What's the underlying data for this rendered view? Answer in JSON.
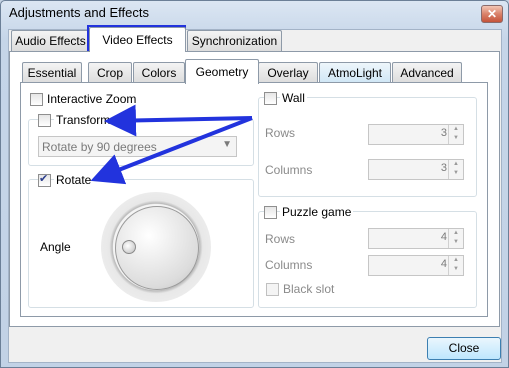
{
  "window": {
    "title": "Adjustments and Effects",
    "close_glyph": "✕"
  },
  "main_tabs": [
    {
      "label": "Audio Effects"
    },
    {
      "label": "Video Effects",
      "active": true
    },
    {
      "label": "Synchronization"
    }
  ],
  "sub_tabs": [
    {
      "label": "Essential"
    },
    {
      "label": "Crop"
    },
    {
      "label": "Colors"
    },
    {
      "label": "Geometry",
      "active": true
    },
    {
      "label": "Overlay"
    },
    {
      "label": "AtmoLight"
    },
    {
      "label": "Advanced"
    }
  ],
  "geometry": {
    "interactive_zoom": {
      "label": "Interactive Zoom",
      "checked": false
    },
    "transform": {
      "label": "Transform",
      "checked": false,
      "select_value": "Rotate by 90 degrees"
    },
    "rotate": {
      "label": "Rotate",
      "checked": true,
      "angle_label": "Angle"
    },
    "wall": {
      "label": "Wall",
      "checked": false,
      "rows_label": "Rows",
      "rows_value": "3",
      "columns_label": "Columns",
      "columns_value": "3"
    },
    "puzzle": {
      "label": "Puzzle game",
      "checked": false,
      "rows_label": "Rows",
      "rows_value": "4",
      "columns_label": "Columns",
      "columns_value": "4",
      "black_slot_label": "Black slot"
    }
  },
  "footer": {
    "close_label": "Close"
  },
  "colors": {
    "annotation": "#2233dd",
    "titlebar": "#c3d1e2"
  }
}
